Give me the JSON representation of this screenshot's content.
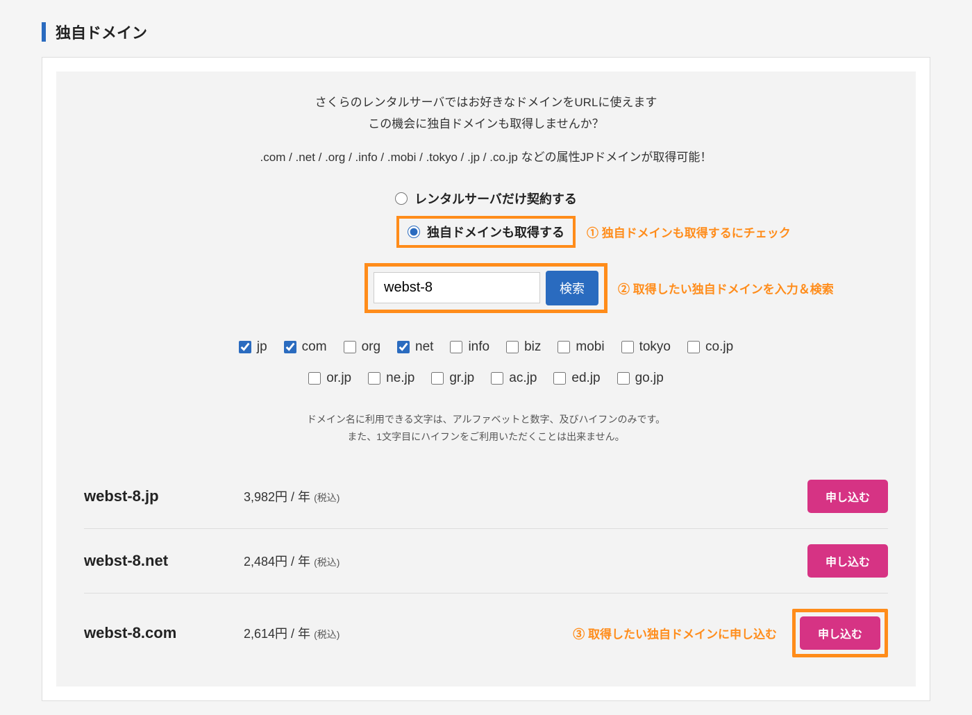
{
  "section_title": "独自ドメイン",
  "intro": {
    "line1": "さくらのレンタルサーバではお好きなドメインをURLに使えます",
    "line2": "この機会に独自ドメインも取得しませんか？",
    "line3": ".com / .net / .org / .info / .mobi / .tokyo / .jp / .co.jp などの属性JPドメインが取得可能！"
  },
  "radios": {
    "option1": "レンタルサーバだけ契約する",
    "option2": "独自ドメインも取得する"
  },
  "annotations": {
    "a1": "① 独自ドメインも取得するにチェック",
    "a2": "② 取得したい独自ドメインを入力＆検索",
    "a3": "③ 取得したい独自ドメインに申し込む"
  },
  "search": {
    "value": "webst-8",
    "button": "検索"
  },
  "tlds": [
    {
      "label": "jp",
      "checked": true
    },
    {
      "label": "com",
      "checked": true
    },
    {
      "label": "org",
      "checked": false
    },
    {
      "label": "net",
      "checked": true
    },
    {
      "label": "info",
      "checked": false
    },
    {
      "label": "biz",
      "checked": false
    },
    {
      "label": "mobi",
      "checked": false
    },
    {
      "label": "tokyo",
      "checked": false
    },
    {
      "label": "co.jp",
      "checked": false
    },
    {
      "label": "or.jp",
      "checked": false
    },
    {
      "label": "ne.jp",
      "checked": false
    },
    {
      "label": "gr.jp",
      "checked": false
    },
    {
      "label": "ac.jp",
      "checked": false
    },
    {
      "label": "ed.jp",
      "checked": false
    },
    {
      "label": "go.jp",
      "checked": false
    }
  ],
  "help": {
    "line1": "ドメイン名に利用できる文字は、アルファベットと数字、及びハイフンのみです。",
    "line2": "また、1文字目にハイフンをご利用いただくことは出来ません。"
  },
  "results": [
    {
      "domain": "webst-8.jp",
      "price": "3,982円 / 年",
      "tax": "(税込)",
      "btn": "申し込む",
      "highlight": false
    },
    {
      "domain": "webst-8.net",
      "price": "2,484円 / 年",
      "tax": "(税込)",
      "btn": "申し込む",
      "highlight": false
    },
    {
      "domain": "webst-8.com",
      "price": "2,614円 / 年",
      "tax": "(税込)",
      "btn": "申し込む",
      "highlight": true
    }
  ]
}
